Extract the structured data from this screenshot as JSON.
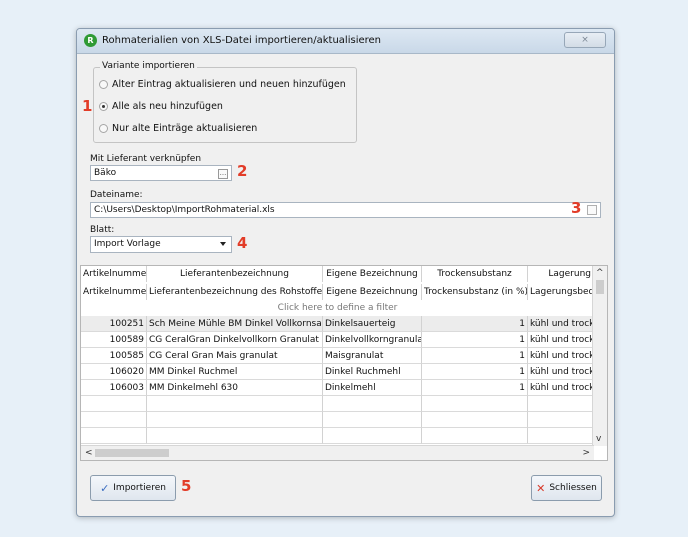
{
  "window": {
    "title": "Rohmaterialien von XLS-Datei importieren/aktualisieren",
    "app_icon_letter": "R",
    "close_label": "×"
  },
  "variant_group": {
    "legend": "Variante importieren",
    "options": [
      {
        "label": "Alter Eintrag aktualisieren und neuen hinzufügen",
        "checked": false
      },
      {
        "label": "Alle als neu hinzufügen",
        "checked": true
      },
      {
        "label": "Nur alte Einträge aktualisieren",
        "checked": false
      }
    ]
  },
  "supplier": {
    "label": "Mit Lieferant verknüpfen",
    "value": "Bäko"
  },
  "file": {
    "label": "Dateiname:",
    "value": "C:\\Users\\Desktop\\ImportRohmaterial.xls"
  },
  "sheet": {
    "label": "Blatt:",
    "value": "Import Vorlage"
  },
  "callouts": [
    "1",
    "2",
    "3",
    "4",
    "5"
  ],
  "grid": {
    "columns": [
      "Artikelnummer",
      "Lieferantenbezeichnung",
      "Eigene Bezeichnung",
      "Trockensubstanz",
      "Lagerung"
    ],
    "subheaders": [
      "Artikelnummer",
      "Lieferantenbezeichnung des Rohstoffes",
      "Eigene Bezeichnung",
      "Trockensubstanz (in %)",
      "Lagerungsbedi"
    ],
    "filter_text": "Click here to define a filter",
    "rows": [
      [
        "100251",
        "Sch Meine Mühle BM Dinkel Vollkornsauer",
        "Dinkelsauerteig",
        "1",
        "kühl und trocke"
      ],
      [
        "100589",
        "CG CeralGran Dinkelvollkorn Granulat",
        "Dinkelvollkorngranulat",
        "1",
        "kühl und trocke"
      ],
      [
        "100585",
        "CG Ceral Gran Mais granulat",
        "Maisgranulat",
        "1",
        "kühl und trocke"
      ],
      [
        "106020",
        "MM Dinkel Ruchmel",
        "Dinkel Ruchmehl",
        "1",
        "kühl und trocke"
      ],
      [
        "106003",
        "MM Dinkelmehl 630",
        "Dinkelmehl",
        "1",
        "kühl und trocke"
      ]
    ]
  },
  "buttons": {
    "import": "Importieren",
    "close": "Schliessen"
  },
  "colors": {
    "callout": "#e23c28",
    "background": "#e7f0f8",
    "dialog": "#f0f0f0"
  }
}
